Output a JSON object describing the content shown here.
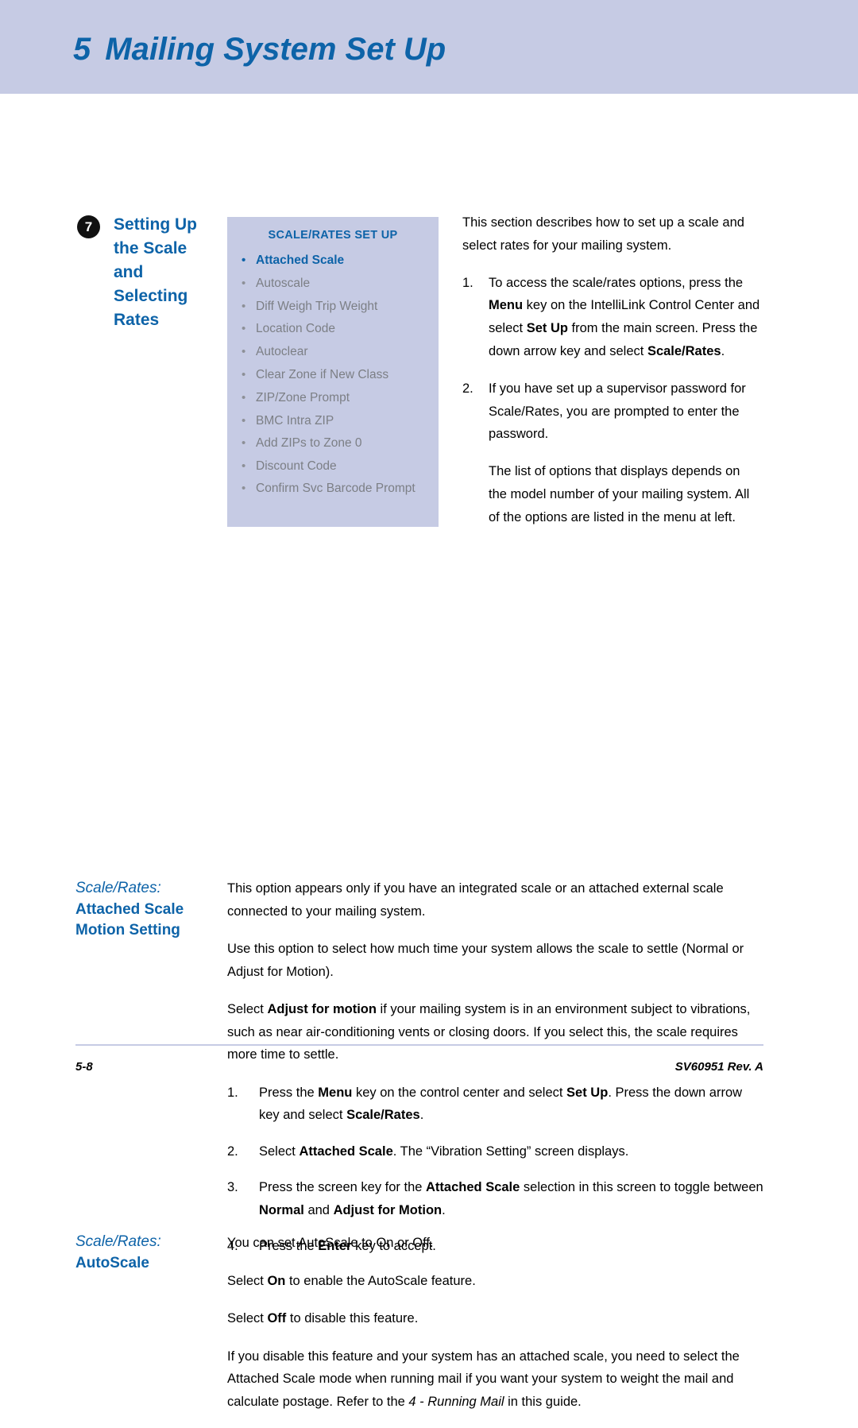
{
  "header": {
    "chapter_number": "5",
    "chapter_title": "Mailing System Set Up"
  },
  "section7": {
    "badge": "7",
    "heading": "Setting Up the Scale and Selecting Rates",
    "menu_box": {
      "title": "SCALE/RATES SET UP",
      "items": [
        "Attached Scale",
        "Autoscale",
        "Diff Weigh Trip Weight",
        "Location Code",
        "Autoclear",
        "Clear Zone if New Class",
        "ZIP/Zone Prompt",
        "BMC Intra ZIP",
        "Add ZIPs to Zone 0",
        "Discount Code",
        "Confirm Svc Barcode Prompt"
      ]
    },
    "intro_paragraph": "This section describes how to set up a scale and select rates for your mailing system.",
    "step1_num": "1.",
    "step1_a": "To access the scale/rates options, press the ",
    "step1_b": "Menu",
    "step1_c": " key on the IntelliLink Control Center and select ",
    "step1_d": "Set Up",
    "step1_e": " from the main screen. Press the down arrow key and select ",
    "step1_f": "Scale/Rates",
    "step1_g": ".",
    "step2_num": "2.",
    "step2_text": "If you have set up a supervisor password for Scale/Rates, you are prompted to enter the password.",
    "step2_note": "The list of options that displays depends on the model number of your mailing system. All of the options are listed in the menu at left."
  },
  "motion_section": {
    "heading_italic": "Scale/Rates:",
    "heading_bold_line1": "Attached Scale",
    "heading_bold_line2": "Motion Setting",
    "para1": "This option appears only if you have an integrated scale or an attached external scale connected to your mailing system.",
    "para2": "Use this option to select how much time your system allows the scale to settle (Normal or Adjust for Motion).",
    "para3_a": "Select ",
    "para3_b": "Adjust for motion",
    "para3_c": " if your mailing system is in an environment subject to vibrations, such as near air-conditioning vents or closing doors. If you select this, the scale requires more time to settle.",
    "steps": [
      {
        "num": "1.",
        "a": "Press the ",
        "b": "Menu",
        "c": " key on the control center and select ",
        "d": "Set Up",
        "e": ". Press the down arrow key and select ",
        "f": "Scale/Rates",
        "g": "."
      },
      {
        "num": "2.",
        "a": "Select ",
        "b": "Attached Scale",
        "c": ". The “Vibration Setting” screen displays.",
        "d": "",
        "e": "",
        "f": "",
        "g": ""
      },
      {
        "num": "3.",
        "a": "Press the screen key for the ",
        "b": "Attached Scale",
        "c": " selection in this screen to toggle between ",
        "d": "Normal",
        "e": " and ",
        "f": "Adjust for Motion",
        "g": "."
      },
      {
        "num": "4.",
        "a": "Press the ",
        "b": "Enter",
        "c": " key to accept.",
        "d": "",
        "e": "",
        "f": "",
        "g": ""
      }
    ]
  },
  "autoscale_section": {
    "heading_italic": "Scale/Rates:",
    "heading_bold": "AutoScale",
    "para1": "You can set AutoScale to On or Off.",
    "para2_a": "Select ",
    "para2_b": "On",
    "para2_c": " to enable the AutoScale feature.",
    "para3_a": "Select ",
    "para3_b": "Off",
    "para3_c": " to disable this feature.",
    "para4_a": "If you disable this feature and your system has an attached scale, you need to select the Attached Scale mode when running mail if you want your system to weight the mail and calculate postage. Refer to the ",
    "para4_b": "4 - Running Mail",
    "para4_c": " in this guide."
  },
  "footer": {
    "page_number": "5-8",
    "doc_id": "SV60951 Rev. A"
  },
  "colors": {
    "band": "#c6cbe4",
    "accent_blue": "#0d63a8",
    "menu_gray": "#7c7f85"
  }
}
